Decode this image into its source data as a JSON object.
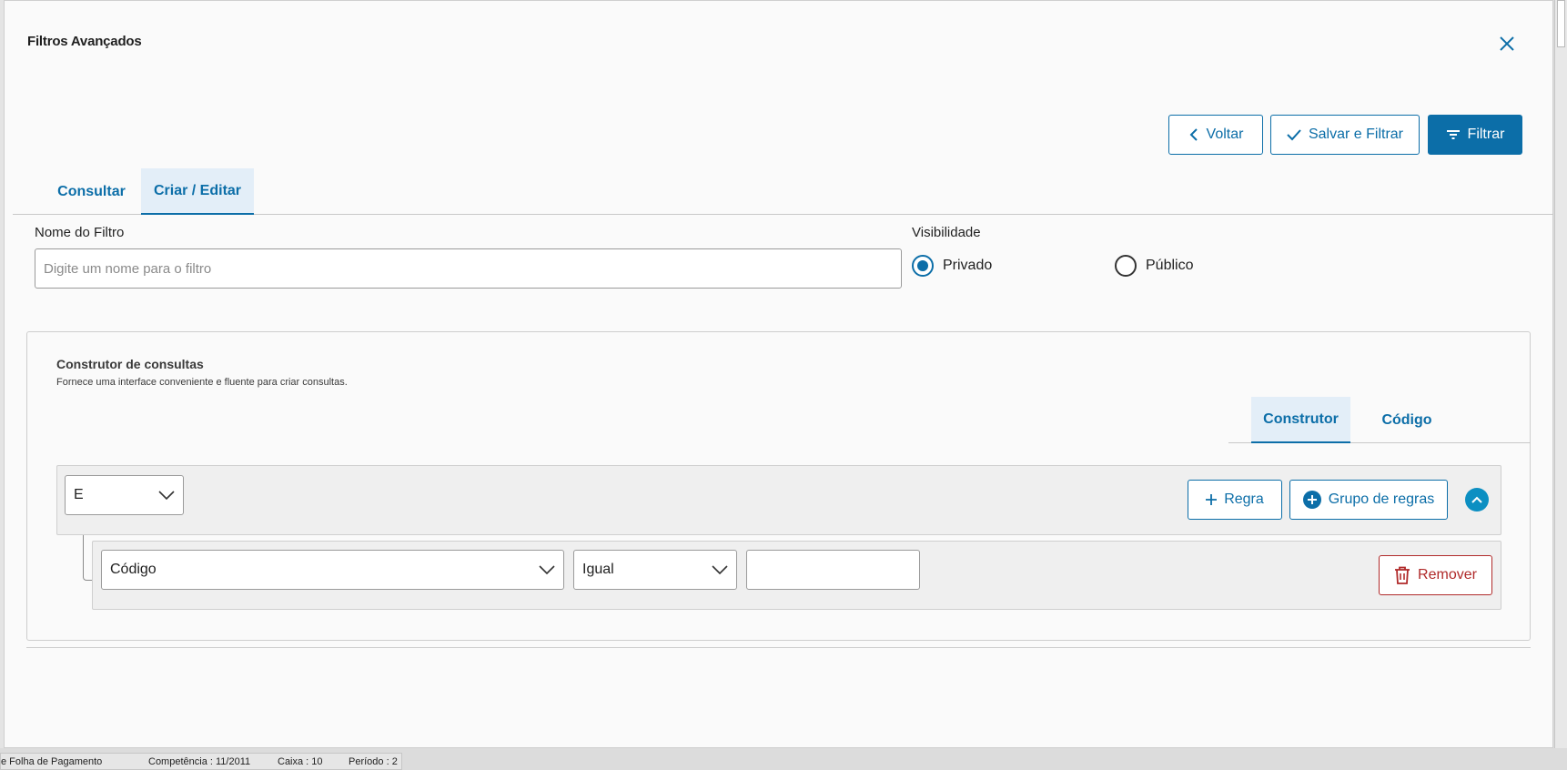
{
  "dialog": {
    "title": "Filtros Avançados",
    "close_icon": "close-icon"
  },
  "toolbar": {
    "back_label": "Voltar",
    "save_filter_label": "Salvar e Filtrar",
    "filter_label": "Filtrar"
  },
  "tabs": [
    {
      "label": "Consultar",
      "active": false
    },
    {
      "label": "Criar / Editar",
      "active": true
    }
  ],
  "form": {
    "name_label": "Nome do Filtro",
    "name_placeholder": "Digite um nome para o filtro",
    "name_value": "",
    "visibility_label": "Visibilidade",
    "visibility_options": [
      {
        "label": "Privado",
        "checked": true
      },
      {
        "label": "Público",
        "checked": false
      }
    ]
  },
  "query_builder": {
    "title": "Construtor de consultas",
    "subtitle": "Fornece uma interface conveniente e fluente para criar consultas.",
    "tabs": [
      {
        "label": "Construtor",
        "active": true
      },
      {
        "label": "Código",
        "active": false
      }
    ],
    "group": {
      "condition": "E",
      "add_rule_label": "Regra",
      "add_group_label": "Grupo de regras"
    },
    "rule": {
      "field": "Código",
      "operator": "Igual",
      "value": "",
      "remove_label": "Remover"
    }
  },
  "statusbar": {
    "module": "e Folha de Pagamento",
    "competencia": "Competência : 11/2011",
    "caixa": "Caixa : 10",
    "periodo": "Período : 2"
  },
  "colors": {
    "primary": "#0c6ea8",
    "danger": "#b02a2a",
    "tab_active_bg": "#e3eef8"
  }
}
